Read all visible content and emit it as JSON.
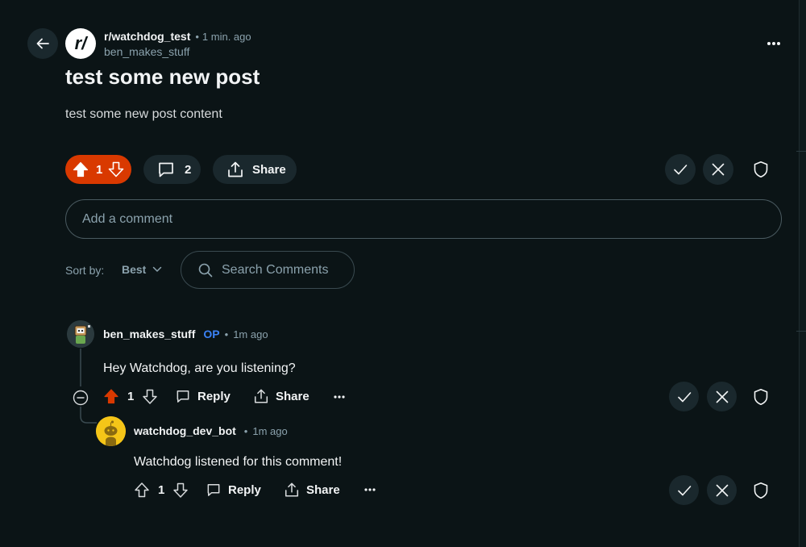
{
  "post": {
    "subreddit": "r/watchdog_test",
    "subreddit_icon_text": "r/",
    "time": "1 min. ago",
    "author": "ben_makes_stuff",
    "title": "test some new post",
    "body": "test some new post content",
    "votes": "1",
    "comments_count": "2",
    "share_label": "Share"
  },
  "composer": {
    "placeholder": "Add a comment"
  },
  "sort": {
    "label": "Sort by:",
    "value": "Best"
  },
  "search": {
    "placeholder": "Search Comments"
  },
  "comments": [
    {
      "author": "ben_makes_stuff",
      "op_badge": "OP",
      "time": "1m ago",
      "text": "Hey Watchdog, are you listening?",
      "votes": "1",
      "reply_label": "Reply",
      "share_label": "Share"
    },
    {
      "author": "watchdog_dev_bot",
      "time": "1m ago",
      "text": "Watchdog listened for this comment!",
      "votes": "1",
      "reply_label": "Reply",
      "share_label": "Share"
    }
  ],
  "colors": {
    "background": "#0b1416",
    "upvote": "#d93900",
    "button": "#1a282d",
    "op": "#3b82f6",
    "muted": "#8ba2ad"
  },
  "icons": [
    "back-arrow-icon",
    "more-icon",
    "upvote-icon",
    "downvote-icon",
    "comment-icon",
    "share-icon",
    "check-icon",
    "close-icon",
    "shield-icon",
    "search-icon",
    "chevron-down-icon",
    "collapse-icon",
    "ellipsis-icon"
  ]
}
